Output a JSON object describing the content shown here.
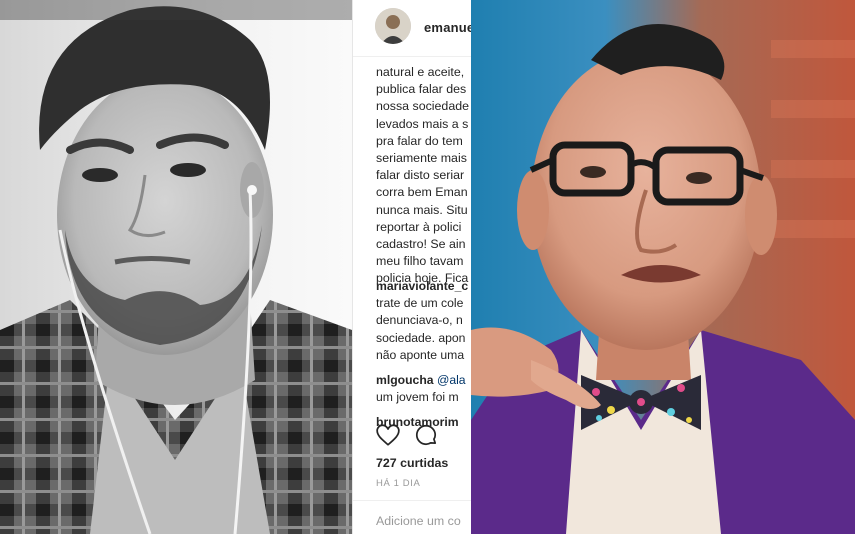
{
  "post": {
    "username": "emanue",
    "caption_lines": [
      "natural e aceite,",
      "publica falar des",
      "nossa sociedade",
      "levados mais a s",
      "pra falar do tem",
      "seriamente mais",
      "falar disto seriar",
      "corra bem Eman",
      "nunca mais. Situ",
      "reportar à polici",
      "cadastro! Se ain",
      "meu filho tavam",
      "policia hoje. Fica"
    ],
    "comments": [
      {
        "user": "mariaviolante_c",
        "lines": [
          "trate de um cole",
          "denunciava-o, n",
          "sociedade. apon",
          "não aponte uma"
        ]
      },
      {
        "user": "mlgoucha",
        "mention": "@ala",
        "lines": [
          "um jovem foi m"
        ]
      },
      {
        "user": "brunotamorim",
        "lines": []
      }
    ],
    "likes": "727 curtidas",
    "time": "HÁ 1 DIA",
    "comment_placeholder": "Adicione um co"
  },
  "icons": {
    "like": "heart-outline-icon",
    "comment": "speech-bubble-icon"
  },
  "colors": {
    "text": "#262626",
    "muted": "#999999",
    "link": "#003569",
    "suit": "#5b2a8a"
  }
}
